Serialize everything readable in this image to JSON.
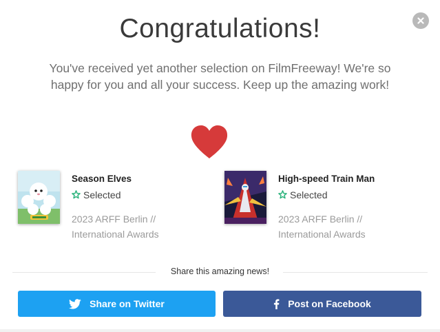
{
  "modal": {
    "title": "Congratulations!",
    "message": "You've received yet another selection on FilmFreeway! We're so happy for you and all your success. Keep up the amazing work!",
    "close_icon": "close-icon",
    "heart_icon": "heart-icon",
    "heart_color": "#d63a3a"
  },
  "films": [
    {
      "title": "Season Elves",
      "status": "Selected",
      "festival": "2023 ARFF Berlin // International Awards",
      "poster_icon": "poster-season-elves"
    },
    {
      "title": "High-speed Train Man",
      "status": "Selected",
      "festival": "2023 ARFF Berlin // International Awards",
      "poster_icon": "poster-high-speed-train-man"
    }
  ],
  "share": {
    "label": "Share this amazing news!",
    "twitter_label": "Share on Twitter",
    "facebook_label": "Post on Facebook",
    "twitter_color": "#1da1f2",
    "facebook_color": "#3b5998",
    "status_color": "#2ab27b"
  }
}
